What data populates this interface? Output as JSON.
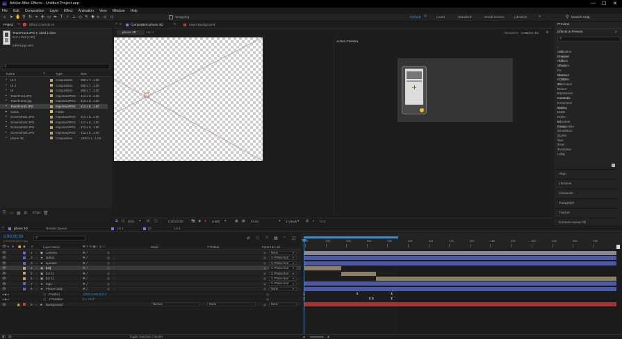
{
  "app": {
    "title": "Adobe After Effects - Untitled Project.aep",
    "window_controls": [
      "—",
      "☐",
      "✕"
    ]
  },
  "menu": [
    "File",
    "Edit",
    "Composition",
    "Layer",
    "Effect",
    "Animation",
    "View",
    "Window",
    "Help"
  ],
  "toolbar": {
    "snapping_label": "Snapping",
    "workspaces": [
      "Default",
      "Learn",
      "Standard",
      "Small Screen",
      "Libraries"
    ],
    "active_workspace": "Default",
    "search_help": "Search Help"
  },
  "project": {
    "tab_project": "Project",
    "tab_effect_controls": "Effect Controls UI",
    "selected_name": "TeamFront.JPG ▾, used 1 time",
    "selected_dims": "412 x 391 (1.00)",
    "used_label": "edited.jpg used",
    "search_placeholder": "",
    "columns": [
      "Name",
      "Type",
      "Size"
    ],
    "items": [
      {
        "name": "UI 1",
        "type": "Composition",
        "size": "360 x 7...1.00",
        "color": "#b8a378"
      },
      {
        "name": "UI 2",
        "type": "Composition",
        "size": "360 x 7...1.00",
        "color": "#b8a378"
      },
      {
        "name": "UI",
        "type": "Composition",
        "size": "360 x 7...1.00",
        "color": "#b8a378"
      },
      {
        "name": "TeamFront.JPG",
        "type": "ImportedJPEG",
        "size": "412 x 8...1.00",
        "color": "#b8a378"
      },
      {
        "name": "TeamFront2.jpg",
        "type": "ImportedJPEG",
        "size": "412 x 8...1.00",
        "color": "#b8a378"
      },
      {
        "name": "TeamFront3.JPG",
        "type": "ImportedJPEG",
        "size": "412 x 8...1.00",
        "color": "#b8a378"
      },
      {
        "name": "Solids",
        "type": "Folder",
        "size": "",
        "color": "#d2c25a"
      },
      {
        "name": "Screenshot1.JPG",
        "type": "ImportedJPEG",
        "size": "412 x 8...1.00",
        "color": "#b8a378"
      },
      {
        "name": "Screenshot2.JPG",
        "type": "ImportedJPEG",
        "size": "412 x 8...1.00",
        "color": "#b8a378"
      },
      {
        "name": "Screenshot3.JPG",
        "type": "ImportedJPEG",
        "size": "412 x 8...1.00",
        "color": "#b8a378"
      },
      {
        "name": "Screenshot4.JPG",
        "type": "ImportedJPEG",
        "size": "412 x 8...1.00",
        "color": "#b8a378"
      },
      {
        "name": "phone 3D",
        "type": "Composition",
        "size": "1920 x 1...1.00",
        "color": "#b8a378"
      }
    ],
    "selected_index": 5,
    "bpc": "8 bpc"
  },
  "composition": {
    "tab_label": "Composition phone 3D",
    "layer_tab": "Layer Background",
    "subtabs": [
      "phone 3D",
      "UI 1"
    ],
    "renderer": "Renderer:",
    "renderer_value": "CINEMA 4D",
    "view_label": "Active Camera",
    "zoom": "50%",
    "timecode": "0;00;00;00",
    "quality": "(Half)",
    "view_mode": "Front",
    "views": "2 Views",
    "offset": "+0.0"
  },
  "right_panel": {
    "preview": "Preview",
    "effects_presets": "Effects & Presets",
    "search_value": "",
    "categories": [
      "Animation Presets",
      "3D Channel",
      "Audio",
      "Blur & Sharpen",
      "Boris FX Mocha",
      "Channel",
      "CINEMA 4D",
      "Color Correction",
      "Distort",
      "Expression Controls",
      "Generate",
      "Immersive Video",
      "Keying",
      "Matte",
      "Noise & Grain",
      "Obsolete",
      "Perspective",
      "Simulation",
      "Stylize",
      "Text",
      "Time",
      "Transition",
      "Utility"
    ],
    "sections": [
      "Align",
      "Libraries",
      "Character",
      "Paragraph",
      "Tracker",
      "Content-Aware Fill"
    ]
  },
  "timeline": {
    "tabs": [
      "phone 3D",
      "Render Queue",
      "UI 1",
      "UI",
      "UI 2"
    ],
    "timecode": "0;00;00;00",
    "fps": "0:00:00:00 (29.97 fps)",
    "search_value": "",
    "columns": {
      "name": "Layer Name",
      "mode": "Mode",
      "trkmat": "T  TrkMat",
      "parent": "Parent & Link"
    },
    "ruler": [
      "0s",
      "02s",
      "04s",
      "06s",
      "08s",
      "10s",
      "12s",
      "14s",
      "16s",
      "18s",
      "20s",
      "22s",
      "24s",
      "26s",
      "28s"
    ],
    "layers": [
      {
        "num": "1",
        "name": "Camera",
        "icon": "◼",
        "parent": "None",
        "color": "#6a70c8",
        "bar": "#8c8690",
        "bar_start": 0,
        "bar_end": 1
      },
      {
        "num": "2",
        "name": "button",
        "icon": "★",
        "parent": "3. Phone bod",
        "color": "#5b64c0",
        "bar": "#4c5aa5",
        "bar_start": 0,
        "bar_end": 1
      },
      {
        "num": "3",
        "name": "speaker",
        "icon": "★",
        "parent": "3. Phone bod",
        "color": "#5b64c0",
        "bar": "#4c5aa5",
        "bar_start": 0,
        "bar_end": 1
      },
      {
        "num": "4",
        "name": "[UI]",
        "icon": "▣",
        "parent": "3. Phone bod",
        "color": "#b8a378",
        "bar": "#8b7f68",
        "bar_start": 0,
        "bar_end": 0.12
      },
      {
        "num": "5",
        "name": "[UI 2]",
        "icon": "▣",
        "parent": "3. Phone bod",
        "color": "#b8a378",
        "bar": "#8b7f68",
        "bar_start": 0.12,
        "bar_end": 0.23
      },
      {
        "num": "6",
        "name": "[UI 1]",
        "icon": "▣",
        "parent": "3. Phone bod",
        "color": "#b8a378",
        "bar": "#8b7f68",
        "bar_start": 0.23,
        "bar_end": 1
      },
      {
        "num": "7",
        "name": "logo",
        "icon": "★",
        "parent": "3. Phone bod",
        "color": "#5b64c0",
        "bar": "#4c5aa5",
        "bar_start": 0,
        "bar_end": 1
      },
      {
        "num": "8",
        "name": "Phone body",
        "icon": "★",
        "parent": "None",
        "color": "#5b64c0",
        "bar": "#4c5aa5",
        "bar_start": 0,
        "bar_end": 1
      }
    ],
    "props": [
      {
        "name": "Position",
        "value": "1250.0,600.0,0.0"
      },
      {
        "name": "Y Rotation",
        "value": "0 x +0.0°"
      }
    ],
    "background": {
      "num": "9",
      "name": "Background",
      "mode": "Normal",
      "trkmat": "None",
      "parent": "None",
      "color": "#c33b3b",
      "bar": "#a23535"
    },
    "bottom_label": "Toggle Switches / Modes"
  }
}
